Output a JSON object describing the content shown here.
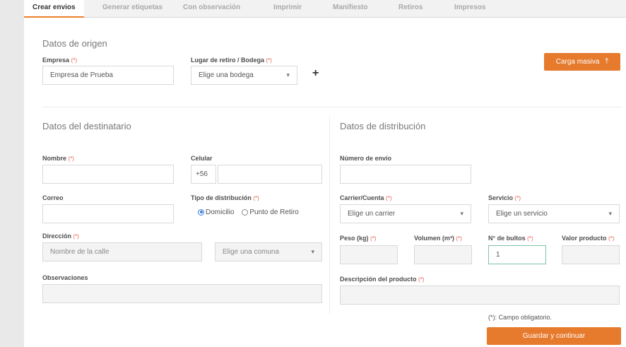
{
  "tabs": [
    "Crear envios",
    "Generar etiquetas",
    "Con observación",
    "Imprimir",
    "Manifiesto",
    "Retiros",
    "Impresos"
  ],
  "origin": {
    "section_title": "Datos de origen",
    "company_label": "Empresa",
    "company_value": "Empresa de Prueba",
    "pickup_label": "Lugar de retiro / Bodega",
    "pickup_value": "Elige una bodega",
    "add_symbol": "+",
    "bulk_button": "Carga masiva"
  },
  "required_mark": "(*)",
  "recipient": {
    "section_title": "Datos del destinatario",
    "name_label": "Nombre",
    "phone_label": "Celular",
    "phone_prefix": "+56",
    "email_label": "Correo",
    "dist_type_label": "Tipo de distribución",
    "opt_home": "Domicilio",
    "opt_pickup": "Punto de Retiro",
    "address_label": "Dirección",
    "street_placeholder": "Nombre de la calle",
    "commune_value": "Elige una comuna",
    "notes_label": "Observaciones"
  },
  "distribution": {
    "section_title": "Datos de distribución",
    "shipment_number_label": "Número de envío",
    "carrier_label": "Carrier/Cuenta",
    "carrier_value": "Elige un carrier",
    "service_label": "Servicio",
    "service_value": "Elige un servicio",
    "weight_label": "Peso (kg)",
    "volume_label": "Volumen (m³)",
    "packages_label": "N° de bultos",
    "packages_value": "1",
    "product_value_label": "Valor producto",
    "description_label": "Descripción del producto"
  },
  "footer": {
    "required_note": "(*): Campo obligatorio.",
    "save_button": "Guardar y continuar"
  },
  "colors": {
    "accent": "#e67a2d",
    "required": "#e8604c",
    "radio": "#3b7ddd"
  }
}
